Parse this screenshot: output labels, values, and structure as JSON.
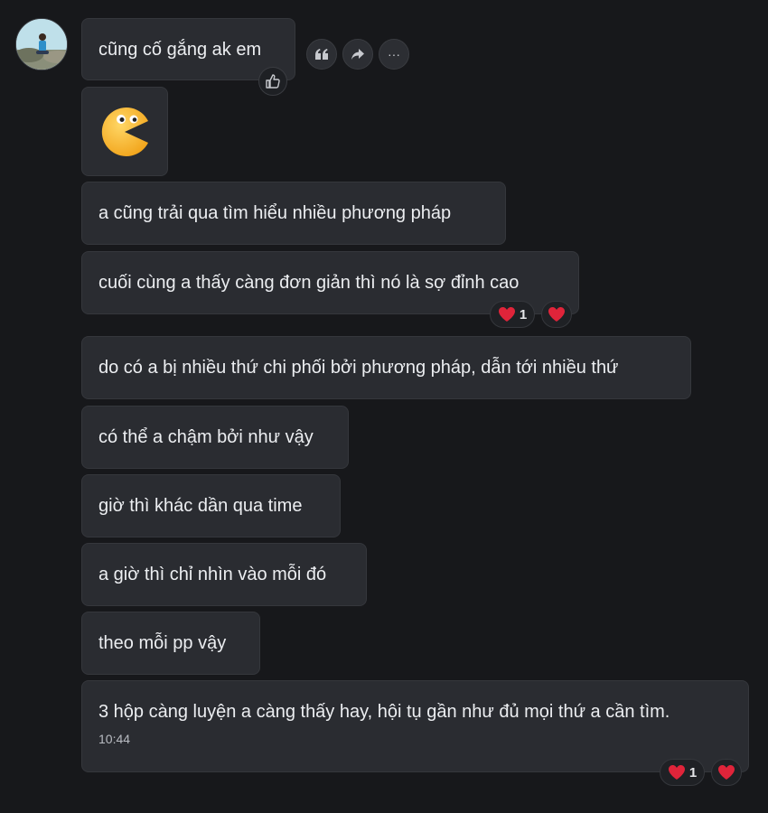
{
  "conversation": {
    "messages": [
      {
        "text": "cũng cố gắng ak em"
      },
      {
        "emoji": "pacman-sticker"
      },
      {
        "text": "a cũng trải qua tìm hiểu nhiều phương pháp"
      },
      {
        "text": "cuối cùng a thấy càng đơn giản thì nó là sợ đỉnh cao",
        "reaction_count": "1"
      },
      {
        "text": "do có a bị nhiều thứ chi phối bởi phương pháp, dẫn tới nhiều thứ"
      },
      {
        "text": "có thể a chậm bởi như vậy"
      },
      {
        "text": "giờ thì khác dần qua time"
      },
      {
        "text": "a giờ thì chỉ nhìn vào mỗi đó"
      },
      {
        "text": "theo mỗi pp vậy"
      },
      {
        "text": "3 hộp càng luyện a càng thấy hay, hội tụ gần như đủ mọi thứ a  cần tìm.",
        "time": "10:44",
        "reaction_count": "1"
      }
    ]
  },
  "message_actions": {
    "icons": [
      "quote-icon",
      "forward-icon",
      "more-icon"
    ],
    "more_label": "···"
  },
  "like_icon": "thumbs-up-icon",
  "reaction_icon": "heart-icon",
  "colors": {
    "background": "#17181b",
    "bubble": "#2a2c31",
    "bubble_border": "#35373c",
    "text": "#eceef1",
    "heart": "#e0243a"
  }
}
